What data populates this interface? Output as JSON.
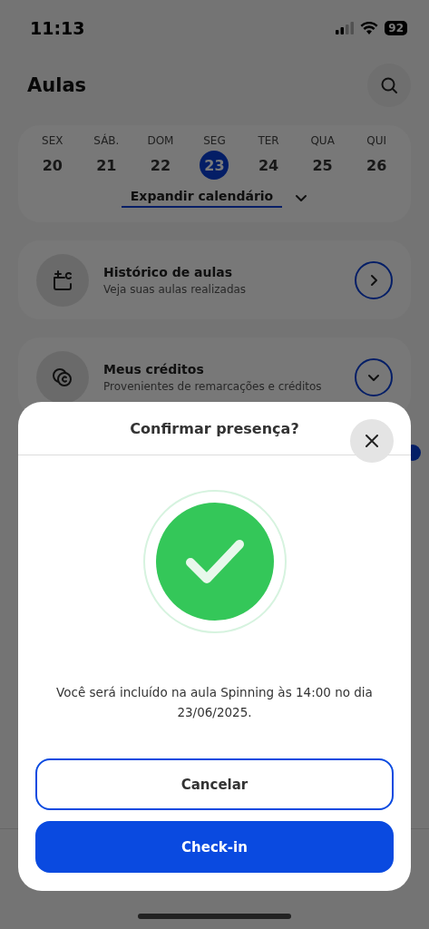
{
  "status_bar": {
    "time": "11:13",
    "battery": "92"
  },
  "header": {
    "title": "Aulas"
  },
  "calendar": {
    "days": [
      {
        "weekday": "SEX",
        "day": "20",
        "selected": false
      },
      {
        "weekday": "SÁB.",
        "day": "21",
        "selected": false
      },
      {
        "weekday": "DOM",
        "day": "22",
        "selected": false
      },
      {
        "weekday": "SEG",
        "day": "23",
        "selected": true
      },
      {
        "weekday": "TER",
        "day": "24",
        "selected": false
      },
      {
        "weekday": "QUA",
        "day": "25",
        "selected": false
      },
      {
        "weekday": "QUI",
        "day": "26",
        "selected": false
      }
    ],
    "expand_label": "Expandir calendário"
  },
  "cards": [
    {
      "kind": "open",
      "title": "Histórico de aulas",
      "subtitle": "Veja suas aulas realizadas"
    },
    {
      "kind": "expand",
      "title": "Meus créditos",
      "subtitle": "Provenientes de remarcações e créditos"
    }
  ],
  "dialog": {
    "title": "Confirmar presença?",
    "message": "Você será incluído na aula Spinning às 14:00 no dia 23/06/2025.",
    "buttons": [
      {
        "kind": "secondary",
        "label": "Cancelar"
      },
      {
        "kind": "primary",
        "label": "Check-in"
      }
    ]
  }
}
